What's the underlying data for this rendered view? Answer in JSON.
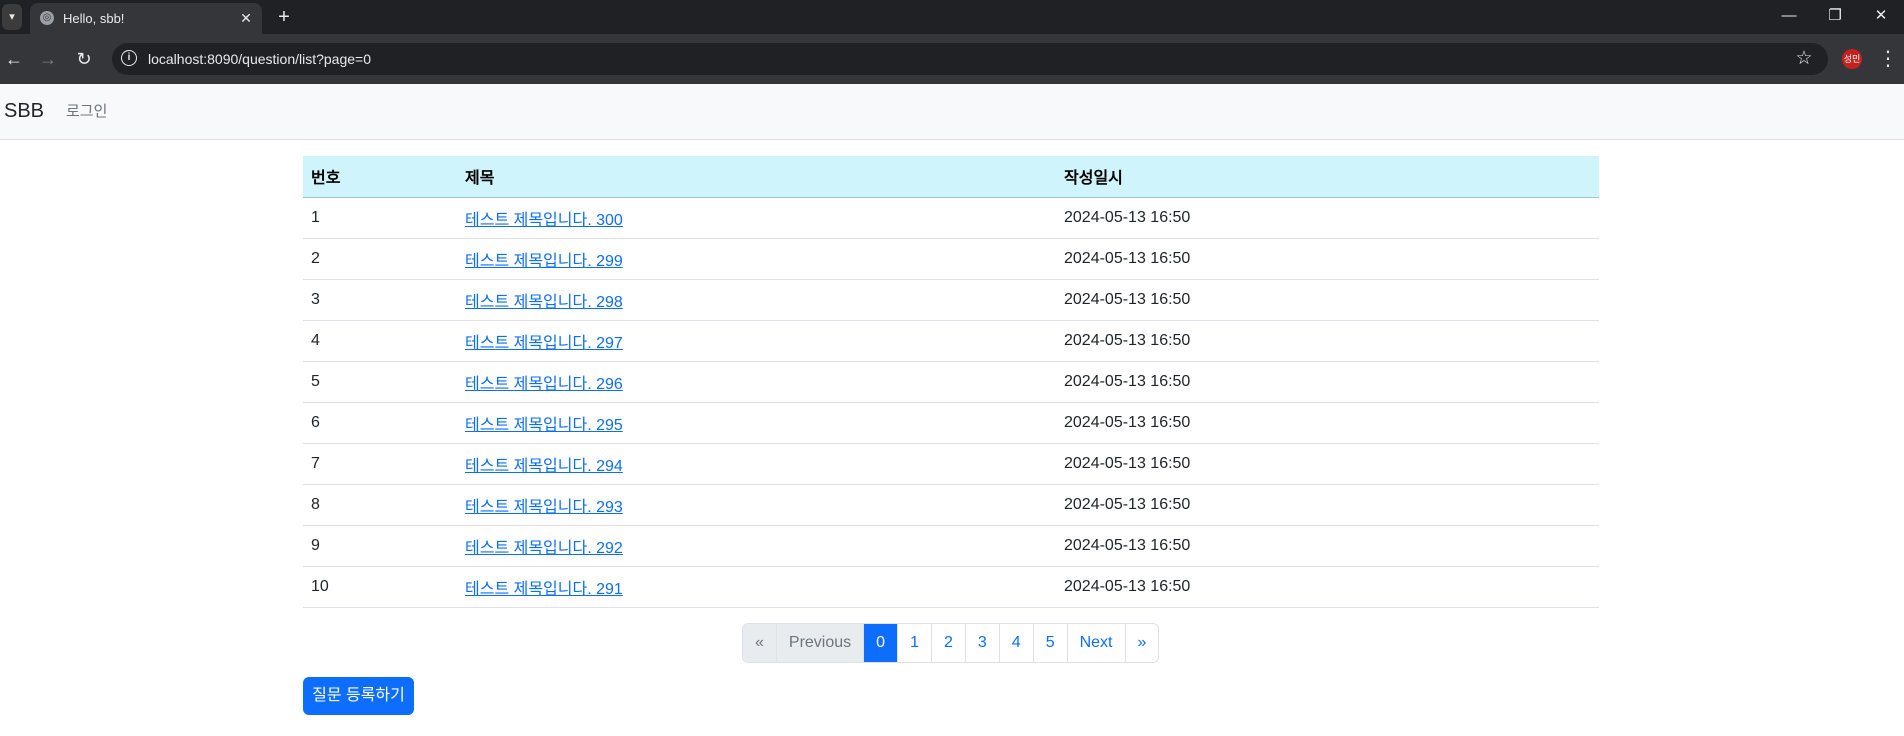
{
  "browser": {
    "tab_title": "Hello, sbb!",
    "tab_search_icon": "▾",
    "favicon_icon": "◎",
    "close_icon": "✕",
    "new_tab_icon": "+",
    "minimize_icon": "—",
    "restore_icon": "❐",
    "close_window_icon": "✕",
    "back_icon": "←",
    "forward_icon": "→",
    "reload_icon": "↻",
    "site_info_icon": "i",
    "url": "localhost:8090/question/list?page=0",
    "bookmark_icon": "☆",
    "profile_label": "성민",
    "menu_icon": "⋮"
  },
  "navbar": {
    "brand": "SBB",
    "login": "로그인"
  },
  "table": {
    "headers": [
      "번호",
      "제목",
      "작성일시"
    ],
    "rows": [
      {
        "num": "1",
        "subject": "테스트 제목입니다. 300",
        "date": "2024-05-13 16:50"
      },
      {
        "num": "2",
        "subject": "테스트 제목입니다. 299",
        "date": "2024-05-13 16:50"
      },
      {
        "num": "3",
        "subject": "테스트 제목입니다. 298",
        "date": "2024-05-13 16:50"
      },
      {
        "num": "4",
        "subject": "테스트 제목입니다. 297",
        "date": "2024-05-13 16:50"
      },
      {
        "num": "5",
        "subject": "테스트 제목입니다. 296",
        "date": "2024-05-13 16:50"
      },
      {
        "num": "6",
        "subject": "테스트 제목입니다. 295",
        "date": "2024-05-13 16:50"
      },
      {
        "num": "7",
        "subject": "테스트 제목입니다. 294",
        "date": "2024-05-13 16:50"
      },
      {
        "num": "8",
        "subject": "테스트 제목입니다. 293",
        "date": "2024-05-13 16:50"
      },
      {
        "num": "9",
        "subject": "테스트 제목입니다. 292",
        "date": "2024-05-13 16:50"
      },
      {
        "num": "10",
        "subject": "테스트 제목입니다. 291",
        "date": "2024-05-13 16:50"
      }
    ]
  },
  "pagination": {
    "first": "«",
    "previous": "Previous",
    "pages": [
      "0",
      "1",
      "2",
      "3",
      "4",
      "5"
    ],
    "active_page": "0",
    "next": "Next",
    "last": "»"
  },
  "ask_button": "질문 등록하기",
  "colors": {
    "primary": "#0d6efd",
    "table_header_bg": "#cff4fc",
    "navbar_bg": "#f8f9fa"
  }
}
